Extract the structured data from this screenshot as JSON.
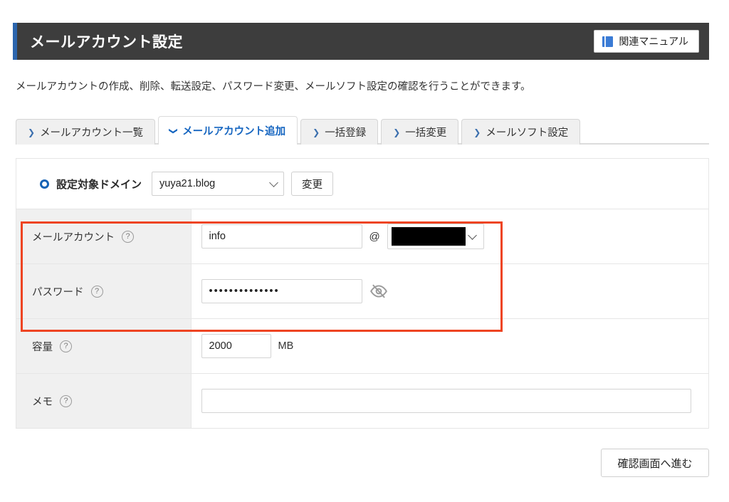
{
  "header": {
    "title": "メールアカウント設定",
    "manual_button_label": "関連マニュアル",
    "manual_icon": "book-icon",
    "accent_color": "#2b65ad",
    "background_color": "#3d3d3d"
  },
  "description": "メールアカウントの作成、削除、転送設定、パスワード変更、メールソフト設定の確認を行うことができます。",
  "tabs": [
    {
      "label": "メールアカウント一覧",
      "icon": "chevron-right-icon",
      "active": false
    },
    {
      "label": "メールアカウント追加",
      "icon": "chevron-down-icon",
      "active": true
    },
    {
      "label": "一括登録",
      "icon": "chevron-right-icon",
      "active": false
    },
    {
      "label": "一括変更",
      "icon": "chevron-right-icon",
      "active": false
    },
    {
      "label": "メールソフト設定",
      "icon": "chevron-right-icon",
      "active": false
    }
  ],
  "domain_row": {
    "radio_icon": "radio-selected-icon",
    "label": "設定対象ドメイン",
    "selected_domain": "yuya21.blog",
    "change_button_label": "変更"
  },
  "fields": [
    {
      "label": "メールアカウント",
      "help_icon": "question-mark-icon",
      "value": "info",
      "placeholder": "",
      "at_sign": "@",
      "domain_select_value": "",
      "domain_redacted": true
    },
    {
      "label": "パスワード",
      "help_icon": "question-mark-icon",
      "value": "••••••••••••••",
      "placeholder": "",
      "toggle_icon": "eye-off-icon"
    },
    {
      "label": "容量",
      "help_icon": "question-mark-icon",
      "value": "2000",
      "unit": "MB"
    },
    {
      "label": "メモ",
      "help_icon": "question-mark-icon",
      "value": "",
      "placeholder": ""
    }
  ],
  "highlight": {
    "color": "#ee4422",
    "covers": [
      "メールアカウント",
      "パスワード"
    ]
  },
  "submit": {
    "label": "確認画面へ進む"
  }
}
